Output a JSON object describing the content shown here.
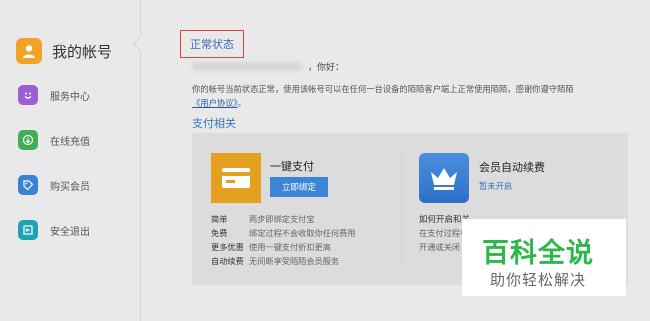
{
  "sidebar": {
    "title": "我的帐号",
    "items": [
      {
        "label": "服务中心",
        "icon": "smiley-icon",
        "color": "#9a5fd1"
      },
      {
        "label": "在线充值",
        "icon": "recharge-icon",
        "color": "#3fae55"
      },
      {
        "label": "购买会员",
        "icon": "tag-icon",
        "color": "#3a82d8"
      },
      {
        "label": "安全退出",
        "icon": "exit-icon",
        "color": "#1ea3b5"
      }
    ]
  },
  "main": {
    "status_label": "正常状态",
    "greeting_suffix": "，你好：",
    "notice_text": "你的帐号当前状态正常，使用该帐号可以在任何一台设备的陌陌客户端上正常使用陌陌，感谢你遵守陌陌",
    "notice_link": "《用户协议》",
    "notice_end": "。",
    "section_title": "支付相关"
  },
  "payment": {
    "title": "一键支付",
    "bind_button": "立即绑定",
    "features": [
      {
        "key": "简单",
        "value": "两步即绑定支付宝"
      },
      {
        "key": "免费",
        "value": "绑定过程不会收取你任何费用"
      },
      {
        "key": "更多优惠",
        "value": "使用一键支付折扣更高"
      },
      {
        "key": "自动续费",
        "value": "无间断享受陌陌会员服务"
      }
    ]
  },
  "vip": {
    "title": "会员自动续费",
    "action": "暂未开启",
    "how_title": "如何开启和关",
    "how_lines": [
      "在支付过程中",
      "开通或关闭"
    ]
  },
  "watermark": {
    "big": "百科全说",
    "small": "助你轻松解决"
  },
  "colors": {
    "accent_blue": "#3b84d6",
    "status_border": "#e04040",
    "pay_orange": "#e6a021",
    "watermark_green": "#2db84a"
  }
}
